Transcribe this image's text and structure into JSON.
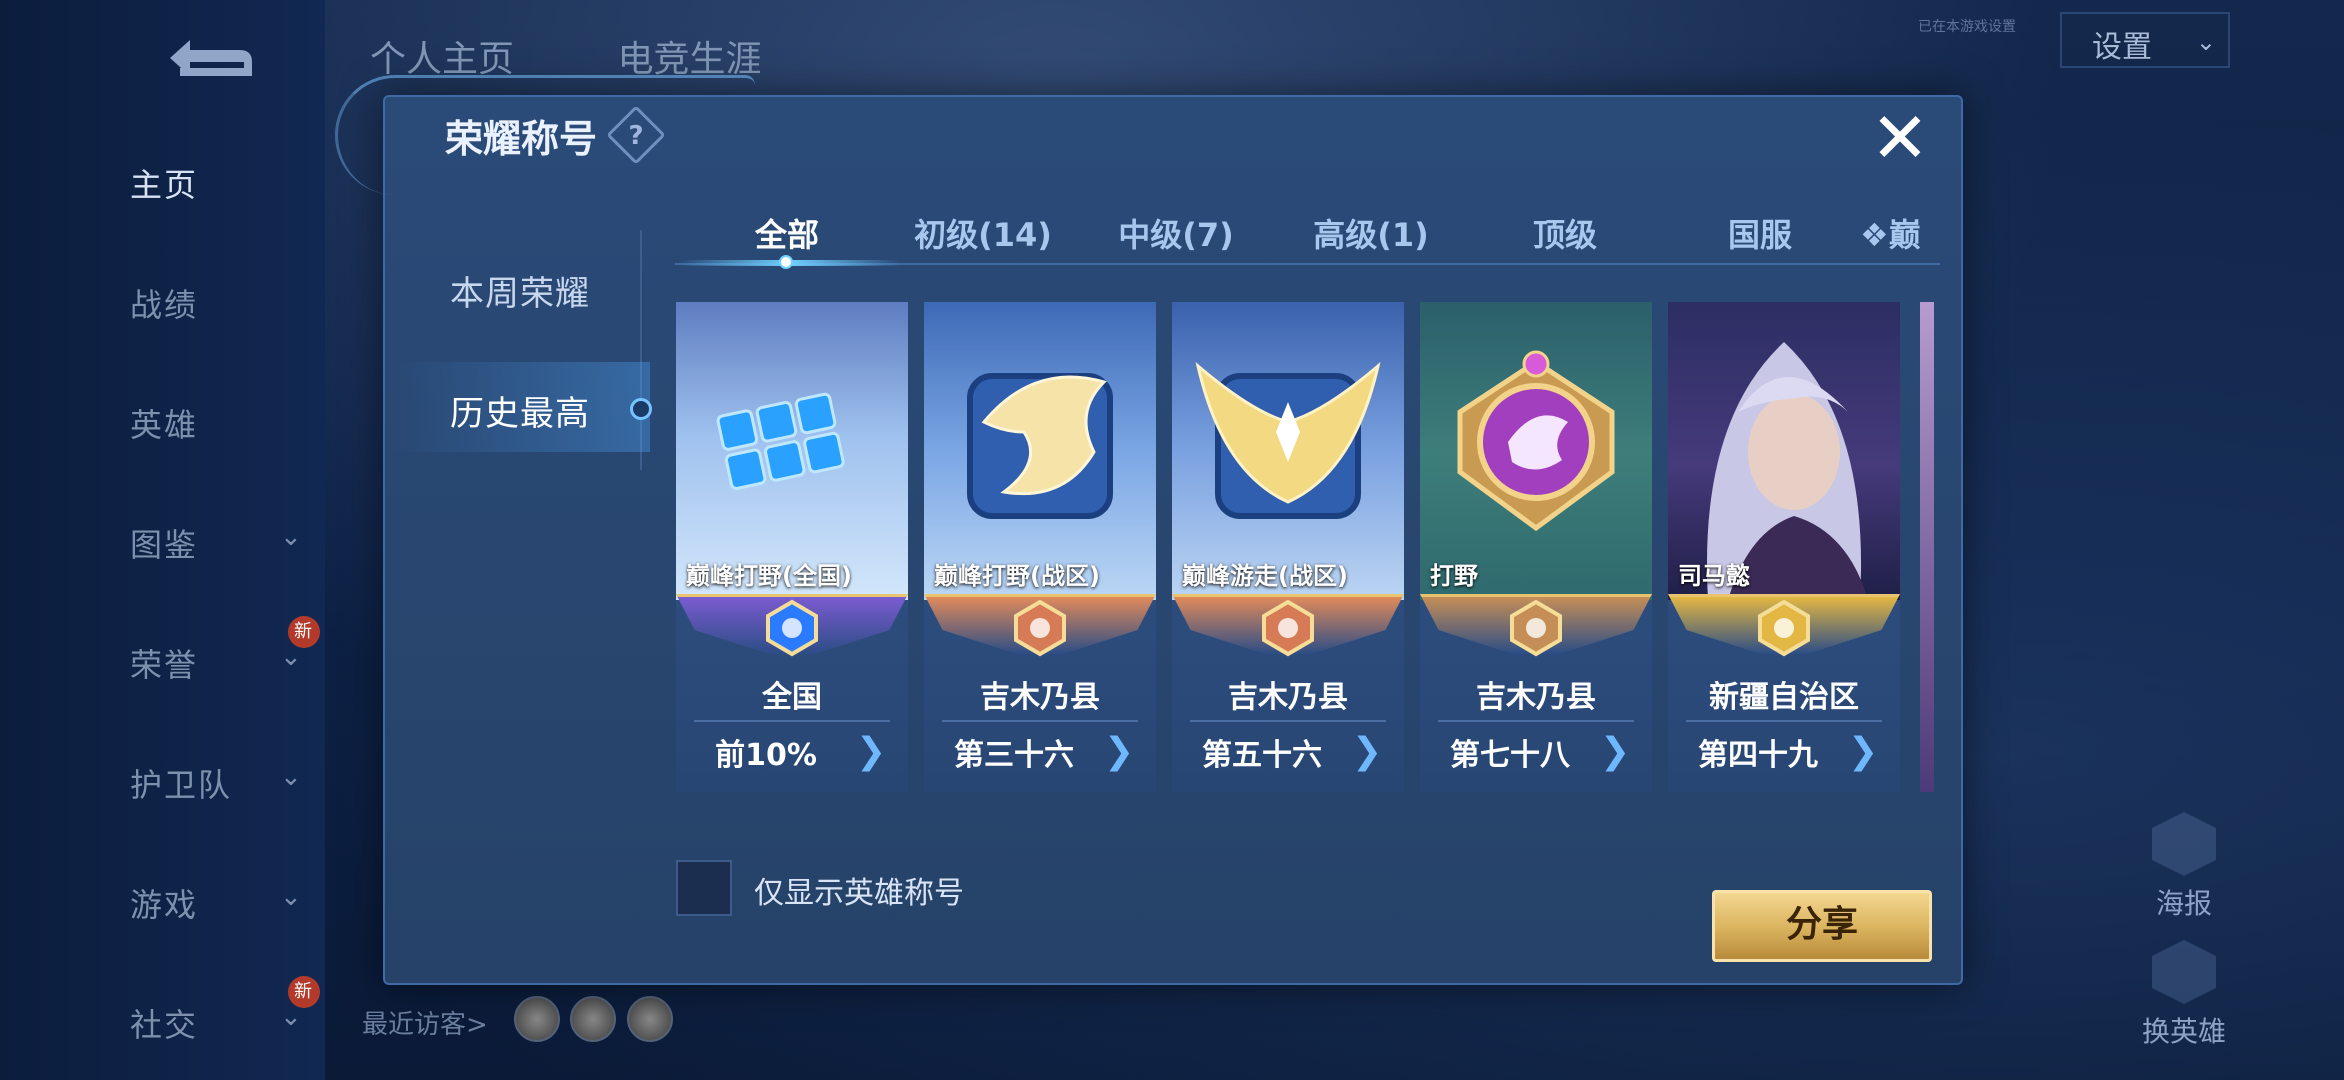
{
  "background": {
    "left_nav": {
      "items": [
        {
          "label": "主页",
          "active": true,
          "has_chevron": false
        },
        {
          "label": "战绩",
          "active": false,
          "has_chevron": false
        },
        {
          "label": "英雄",
          "active": false,
          "has_chevron": false
        },
        {
          "label": "图鉴",
          "active": false,
          "has_chevron": true
        },
        {
          "label": "荣誉",
          "active": false,
          "has_chevron": true,
          "badge": "新"
        },
        {
          "label": "护卫队",
          "active": false,
          "has_chevron": true
        },
        {
          "label": "游戏",
          "active": false,
          "has_chevron": true
        },
        {
          "label": "社交",
          "active": false,
          "has_chevron": true,
          "badge": "新"
        }
      ]
    },
    "top_tabs": [
      "个人主页",
      "电竞生涯"
    ],
    "settings_label": "设置",
    "notice_text": "已在本游戏设置",
    "right_icons": [
      {
        "label": "海报"
      },
      {
        "label": "换英雄"
      }
    ],
    "recent_visitors_label": "最近访客>"
  },
  "modal": {
    "title": "荣耀称号",
    "help_glyph": "?",
    "close_glyph": "✕",
    "side_tabs": [
      {
        "label": "本周荣耀",
        "active": false
      },
      {
        "label": "历史最高",
        "active": true
      }
    ],
    "category_tabs": [
      {
        "label": "全部",
        "active": true
      },
      {
        "label": "初级(14)",
        "active": false
      },
      {
        "label": "中级(7)",
        "active": false
      },
      {
        "label": "高级(1)",
        "active": false
      },
      {
        "label": "顶级",
        "active": false
      },
      {
        "label": "国服",
        "active": false
      },
      {
        "label": "❖巅",
        "active": false
      }
    ],
    "cards": [
      {
        "name": "巅峰打野(全国)",
        "region": "全国",
        "rank": "前10%",
        "art": "blue-tiles-icon",
        "tier_color": "#7b5bd1"
      },
      {
        "name": "巅峰打野(战区)",
        "region": "吉木乃县",
        "rank": "第三十六",
        "art": "gold-dragon-icon",
        "tier_color": "#e08a5a"
      },
      {
        "name": "巅峰游走(战区)",
        "region": "吉木乃县",
        "rank": "第五十六",
        "art": "gold-wings-icon",
        "tier_color": "#e08a5a"
      },
      {
        "name": "打野",
        "region": "吉木乃县",
        "rank": "第七十八",
        "art": "purple-dragon-badge-icon",
        "tier_color": "#c58e57"
      },
      {
        "name": "司马懿",
        "region": "新疆自治区",
        "rank": "第四十九",
        "art": "hero-portrait-icon",
        "tier_color": "#e3b743"
      }
    ],
    "checkbox_label": "仅显示英雄称号",
    "checkbox_checked": false,
    "share_label": "分享"
  },
  "colors": {
    "modal_bg": "#28466f",
    "accent_blue": "#6fd0ff",
    "share_gold": "#d9b25d"
  }
}
